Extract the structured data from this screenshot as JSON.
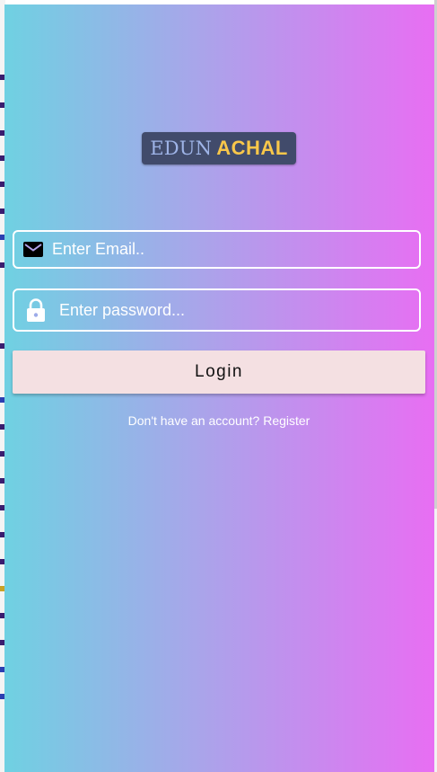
{
  "app": {
    "brand": {
      "word1": "EDUN",
      "word2": "ACHAL"
    },
    "login_form": {
      "email": {
        "value": "",
        "placeholder": "Enter Email.."
      },
      "password": {
        "value": "",
        "placeholder": "Enter password..."
      },
      "login_label": "Login",
      "register_prompt": "Don't have an account?",
      "register_link": "Register"
    }
  },
  "icons": {
    "email": "mail-icon",
    "password": "lock-icon"
  },
  "colors": {
    "gradient_left": "#6fd1e2",
    "gradient_right": "#e86ef3",
    "logo_background": "#414b6b",
    "logo_word1": "#9fb4e8",
    "logo_word2": "#f9c74a",
    "button_background": "#f4e0e2"
  }
}
